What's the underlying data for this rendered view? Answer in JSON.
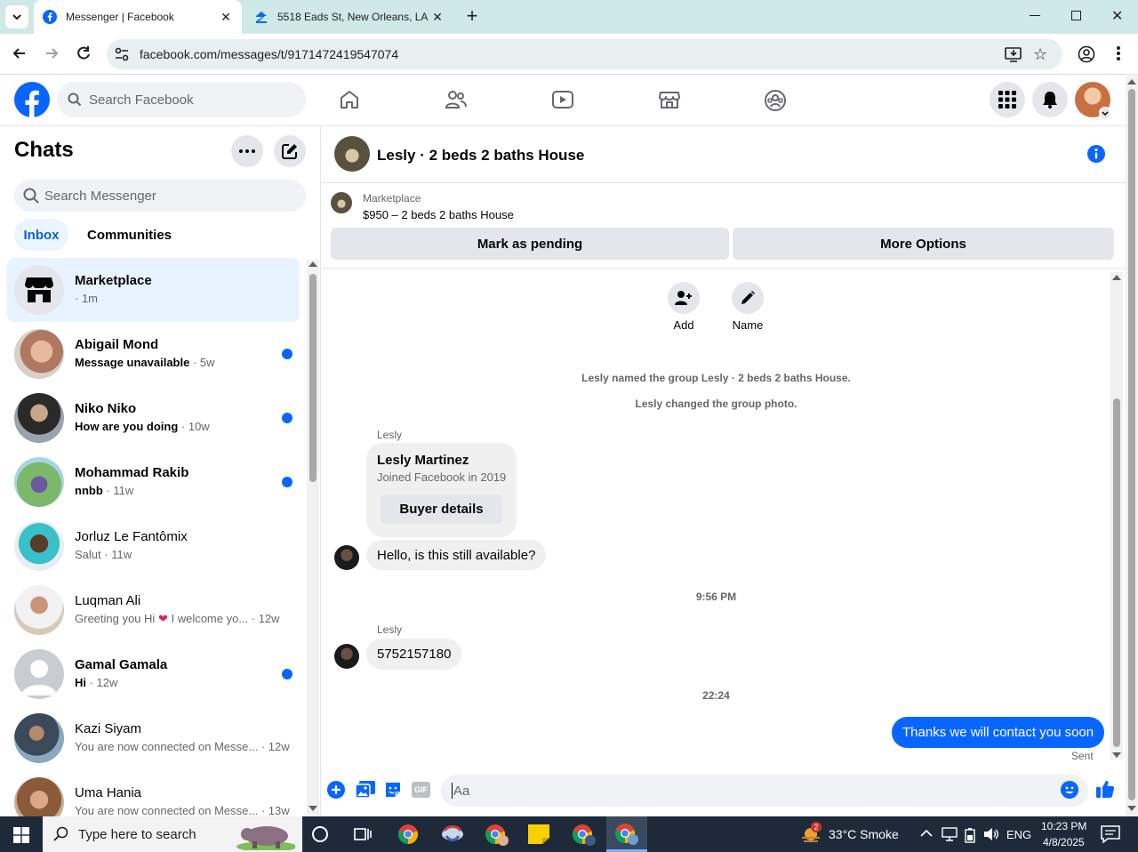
{
  "browser": {
    "tabs": [
      {
        "title": "Messenger | Facebook",
        "active": true
      },
      {
        "title": "5518 Eads St, New Orleans, LA 7",
        "active": false
      }
    ],
    "url": "facebook.com/messages/t/9171472419547074"
  },
  "fb": {
    "search_placeholder": "Search Facebook"
  },
  "sidebar": {
    "title": "Chats",
    "search_placeholder": "Search Messenger",
    "tabs": [
      "Inbox",
      "Communities"
    ],
    "chats": [
      {
        "name": "Marketplace",
        "preview": "",
        "time": "· 1m",
        "unread": false,
        "selected": true
      },
      {
        "name": "Abigail Mond",
        "preview": "Message unavailable",
        "time": " · 5w",
        "unread": true
      },
      {
        "name": "Niko Niko",
        "preview": "How are you doing",
        "time": " · 10w",
        "unread": true
      },
      {
        "name": "Mohammad Rakib",
        "preview": "nnbb",
        "time": " · 11w",
        "unread": true
      },
      {
        "name": "Jorluz Le Fantômix",
        "preview": "Salut",
        "time": " · 11w",
        "unread": false
      },
      {
        "name": "Luqman Ali",
        "preview": "Greeting you Hi",
        "preview2": " I welcome yo...",
        "time": " · 12w",
        "unread": false
      },
      {
        "name": "Gamal Gamala",
        "preview": "Hi",
        "time": " · 12w",
        "unread": true
      },
      {
        "name": "Kazi Siyam",
        "preview": "You are now connected on Messe...",
        "time": " · 12w",
        "unread": false
      },
      {
        "name": "Uma Hania",
        "preview": "You are now connected on Messe...",
        "time": " · 13w",
        "unread": false
      }
    ]
  },
  "conversation": {
    "title": "Lesly · 2 beds 2 baths House",
    "marketplace_label": "Marketplace",
    "listing": "$950 – 2 beds 2 baths House",
    "mark_pending": "Mark as pending",
    "more_options": "More Options",
    "add_label": "Add",
    "name_label": "Name",
    "sys1": "Lesly named the group Lesly · 2 beds 2 baths House.",
    "sys2": "Lesly changed the group photo.",
    "sender": "Lesly",
    "card_name": "Lesly Martinez",
    "card_sub": "Joined Facebook in 2019",
    "buyer_details": "Buyer details",
    "msg1": "Hello, is this still available?",
    "time1": "9:56 PM",
    "msg2": "5752157180",
    "time2": "22:24",
    "my_msg": "Thanks we will contact you soon",
    "sent": "Sent",
    "composer_placeholder": "Aa"
  },
  "taskbar": {
    "search_placeholder": "Type here to search",
    "weather": "33°C  Smoke",
    "weather_badge": "2",
    "lang": "ENG",
    "time": "10:23 PM",
    "date": "4/8/2025"
  },
  "colors": {
    "accent": "#0866ff",
    "tabstrip": "#cfe8e8"
  }
}
